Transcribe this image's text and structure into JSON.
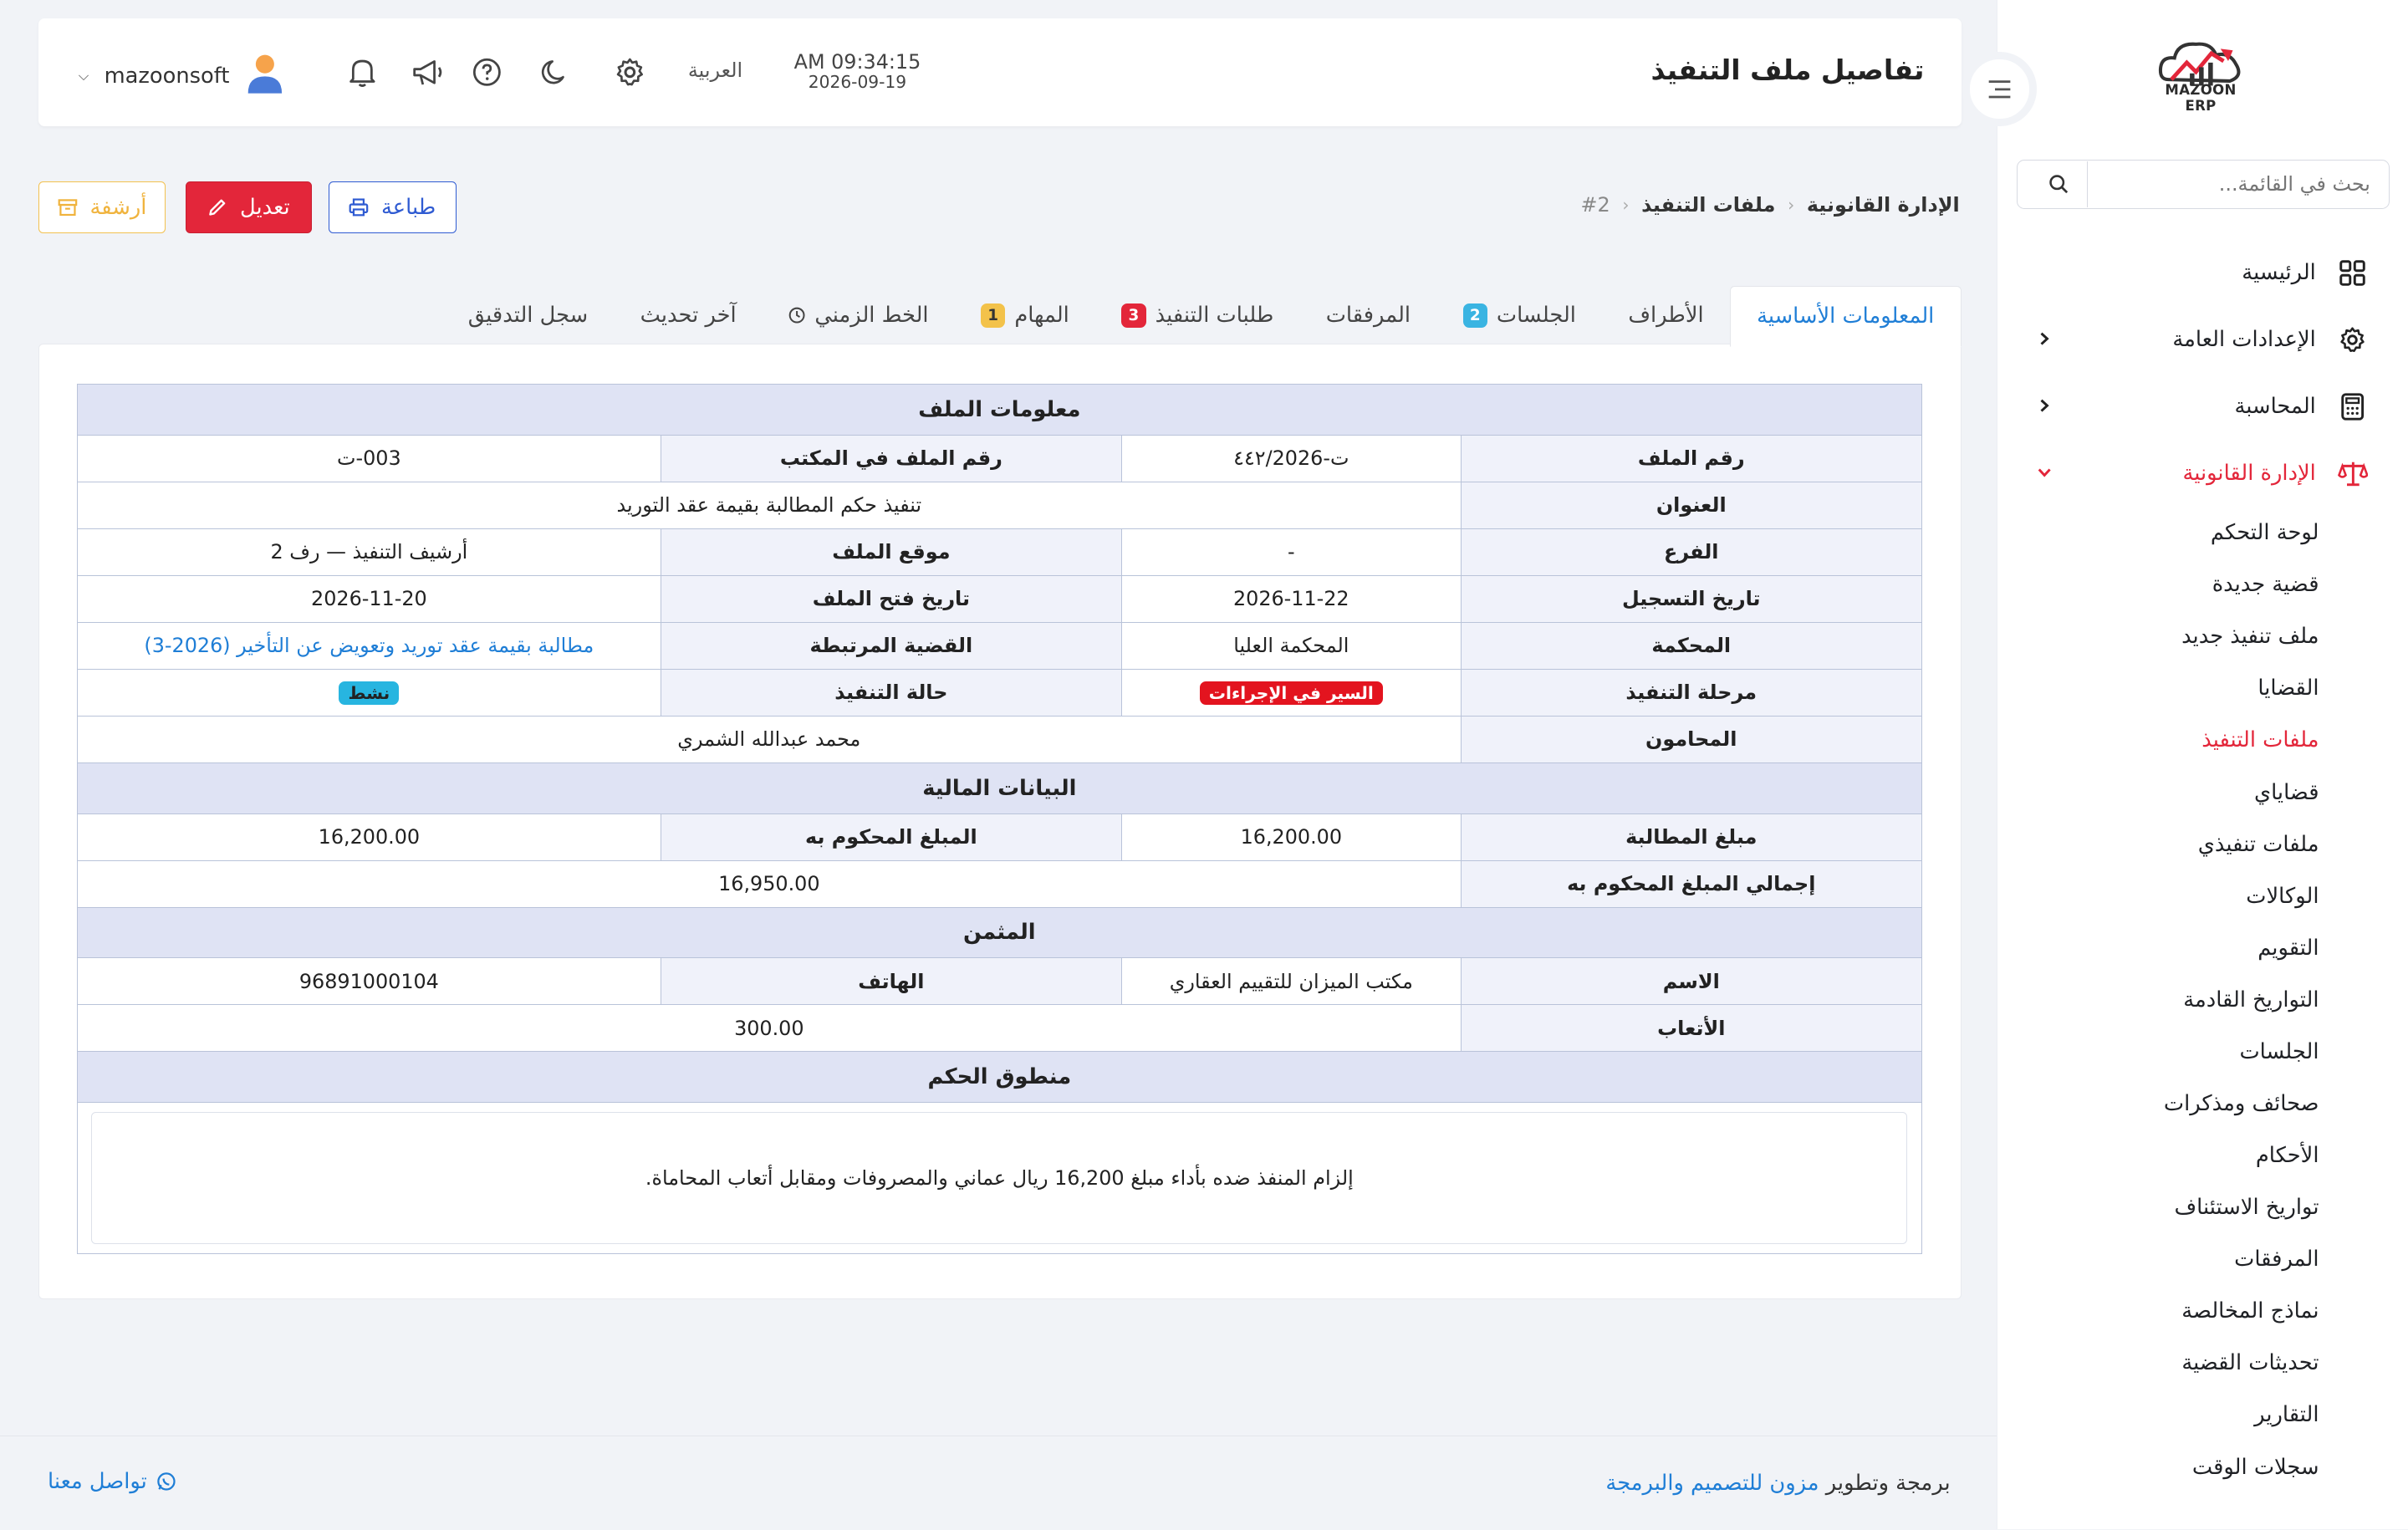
{
  "app": {
    "logo_text": "MAZOON ERP"
  },
  "sidebar": {
    "search_placeholder": "بحث في القائمة...",
    "menu": [
      {
        "label": "الرئيسية",
        "icon": "grid-icon"
      },
      {
        "label": "الإعدادات العامة",
        "icon": "gear-icon"
      },
      {
        "label": "المحاسبة",
        "icon": "calculator-icon"
      },
      {
        "label": "الإدارة القانونية",
        "icon": "scales-icon"
      }
    ],
    "submenu": [
      "لوحة التحكم",
      "قضية جديدة",
      "ملف تنفيذ جديد",
      "القضايا",
      "ملفات التنفيذ",
      "قضاياي",
      "ملفات تنفيذي",
      "الوكالات",
      "التقويم",
      "التواريخ القادمة",
      "الجلسات",
      "صحائف ومذكرات",
      "الأحكام",
      "تواريخ الاستئناف",
      "المرفقات",
      "نماذج المخالصة",
      "تحديثات القضية",
      "التقارير",
      "سجلات الوقت"
    ]
  },
  "header": {
    "title": "تفاصيل ملف التنفيذ",
    "time": "AM 09:34:15",
    "date": "2026-09-19",
    "language": "العربية",
    "username": "mazoonsoft"
  },
  "breadcrumb": {
    "item1": "الإدارة القانونية",
    "item2": "ملفات التنفيذ",
    "item3": "#2"
  },
  "actions": {
    "print": "طباعة",
    "edit": "تعديل",
    "archive": "أرشفة"
  },
  "tabs": [
    {
      "label": "المعلومات الأساسية"
    },
    {
      "label": "الأطراف"
    },
    {
      "label": "الجلسات",
      "badge": "2"
    },
    {
      "label": "المرفقات"
    },
    {
      "label": "طلبات التنفيذ",
      "badge": "3"
    },
    {
      "label": "المهام",
      "badge": "1"
    },
    {
      "label": "الخط الزمني"
    },
    {
      "label": "آخر تحديث"
    },
    {
      "label": "سجل التدقيق"
    }
  ],
  "file_info": {
    "section_title": "معلومات الملف",
    "file_number_label": "رقم الملف",
    "file_number": "ت-٤٤٢/2026",
    "office_file_number_label": "رقم الملف في المكتب",
    "office_file_number": "003-ت",
    "title_label": "العنوان",
    "title": "تنفيذ حكم المطالبة بقيمة عقد التوريد",
    "branch_label": "الفرع",
    "branch": "-",
    "location_label": "موقع الملف",
    "location": "أرشيف التنفيذ — رف 2",
    "registration_date_label": "تاريخ التسجيل",
    "registration_date": "2026-11-22",
    "opening_date_label": "تاريخ فتح الملف",
    "opening_date": "2026-11-20",
    "court_label": "المحكمة",
    "court": "المحكمة العليا",
    "related_case_label": "القضية المرتبطة",
    "related_case": "مطالبة بقيمة عقد توريد وتعويض عن التأخير (2026-3)",
    "stage_label": "مرحلة التنفيذ",
    "stage": "السير في الإجراءات",
    "status_label": "حالة التنفيذ",
    "status": "نشط",
    "lawyers_label": "المحامون",
    "lawyers": "محمد عبدالله الشمري"
  },
  "financial": {
    "section_title": "البيانات المالية",
    "claim_amount_label": "مبلغ المطالبة",
    "claim_amount": "16,200.00",
    "awarded_amount_label": "المبلغ المحكوم به",
    "awarded_amount": "16,200.00",
    "total_awarded_label": "إجمالي المبلغ المحكوم به",
    "total_awarded": "16,950.00"
  },
  "appraiser": {
    "section_title": "المثمن",
    "name_label": "الاسم",
    "name": "مكتب الميزان للتقييم العقاري",
    "phone_label": "الهاتف",
    "phone": "96891000104",
    "fees_label": "الأتعاب",
    "fees": "300.00"
  },
  "verdict": {
    "section_title": "منطوق الحكم",
    "text": "إلزام المنفذ ضده بأداء مبلغ 16,200 ريال عماني والمصروفات ومقابل أتعاب المحاماة."
  },
  "footer": {
    "credit_prefix": "برمجة وتطوير",
    "credit_link": "مزون للتصميم والبرمجة",
    "contact": "تواصل معنا"
  },
  "colors": {
    "primary": "#e3263a",
    "link": "#1f7ed6",
    "section_bg": "#dfe3f4"
  }
}
